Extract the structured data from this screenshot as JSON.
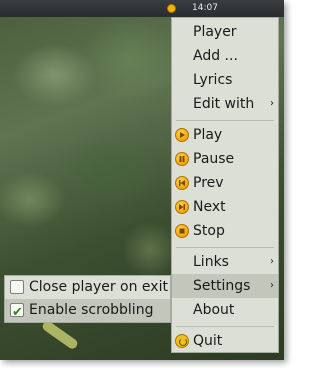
{
  "panel": {
    "clock": "14:07",
    "tray_icon": "player-tray-icon"
  },
  "menu": {
    "items": [
      {
        "label": "Player",
        "icon": "",
        "submenu": false
      },
      {
        "label": "Add ...",
        "icon": "",
        "submenu": false
      },
      {
        "label": "Lyrics",
        "icon": "",
        "submenu": false
      },
      {
        "label": "Edit with",
        "icon": "",
        "submenu": true
      },
      {
        "label": "Play",
        "icon": "play-icon",
        "submenu": false
      },
      {
        "label": "Pause",
        "icon": "pause-icon",
        "submenu": false
      },
      {
        "label": "Prev",
        "icon": "prev-icon",
        "submenu": false
      },
      {
        "label": "Next",
        "icon": "next-icon",
        "submenu": false
      },
      {
        "label": "Stop",
        "icon": "stop-icon",
        "submenu": false
      },
      {
        "label": "Links",
        "icon": "",
        "submenu": true
      },
      {
        "label": "Settings",
        "icon": "",
        "submenu": true,
        "active": true
      },
      {
        "label": "About",
        "icon": "",
        "submenu": false
      },
      {
        "label": "Quit",
        "icon": "quit-icon",
        "submenu": false
      }
    ],
    "submenu_arrow": "›"
  },
  "settings_submenu": {
    "items": [
      {
        "label": "Close player on exit",
        "checked": false
      },
      {
        "label": "Enable scrobbling",
        "checked": true,
        "active": true
      }
    ],
    "check_glyph": "✔"
  },
  "colors": {
    "menu_bg": "#dcdfd6",
    "highlight": "#c3c6bb",
    "icon_accent": "#f0a500"
  }
}
